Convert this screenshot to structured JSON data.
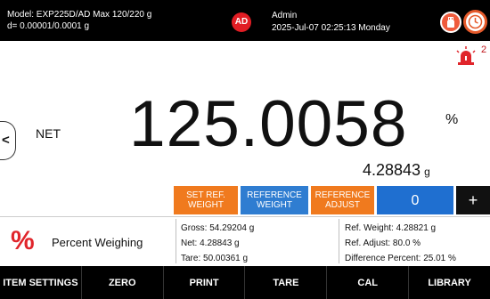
{
  "header": {
    "model_line": "Model: EXP225D/AD   Max 120/220 g",
    "resolution_line": "d= 0.00001/0.0001 g",
    "user_badge": "AD",
    "user_name": "Admin",
    "datetime": "2025-Jul-07 02:25:13 Monday",
    "icons": [
      "usb-icon",
      "clock-icon"
    ]
  },
  "alarm": {
    "icon": "alarm-siren-icon",
    "count": "2"
  },
  "display": {
    "nav_arrow": "<",
    "label": "NET",
    "main_value": "125.0058",
    "main_unit": "%",
    "secondary_value": "4.28843",
    "secondary_unit": "g"
  },
  "actions": {
    "set_ref_weight": "SET REF. WEIGHT",
    "reference_weight": "REFERENCE WEIGHT",
    "reference_adjust": "REFERENCE ADJUST",
    "counter_value": "0",
    "add": "+"
  },
  "info": {
    "mode_icon": "percent-icon",
    "mode_label": "Percent Weighing",
    "gross": "Gross: 54.29204 g",
    "net": "Net: 4.28843 g",
    "tare": "Tare: 50.00361 g",
    "ref_weight": "Ref. Weight: 4.28821 g",
    "ref_adjust": "Ref. Adjust: 80.0 %",
    "difference": "Difference Percent: 25.01 %"
  },
  "toolbar": {
    "item_settings": "ITEM SETTINGS",
    "zero": "ZERO",
    "print": "PRINT",
    "tare": "TARE",
    "cal": "CAL",
    "library": "LIBRARY"
  },
  "colors": {
    "header_bg": "#000000",
    "accent_orange": "#f07a1e",
    "accent_blue": "#2f7dd1",
    "badge_red": "#e11d24"
  }
}
